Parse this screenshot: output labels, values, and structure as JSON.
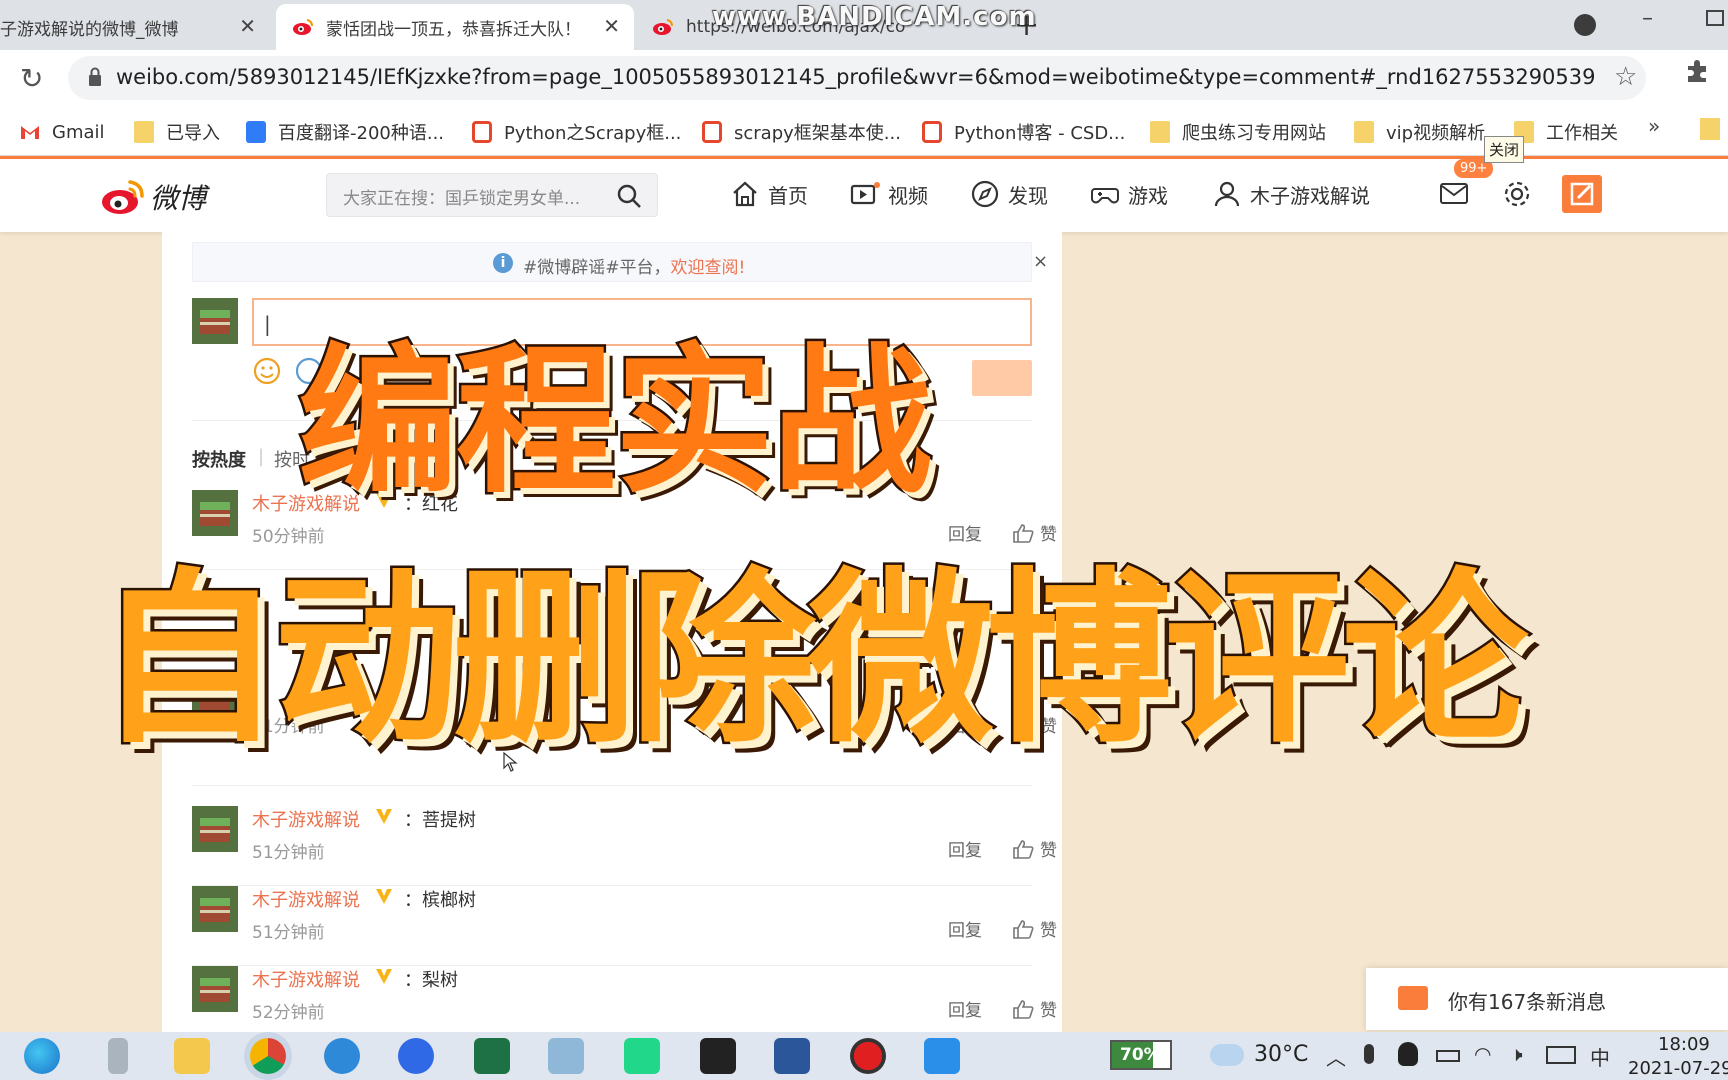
{
  "browser": {
    "tabs": [
      {
        "title": "子游戏解说的微博_微博",
        "close": "✕"
      },
      {
        "title": "蒙恬团战一顶五，恭喜拆迁大队！",
        "close": "✕"
      },
      {
        "title": "https://weibo.com/ajax/co",
        "close": ""
      }
    ],
    "new_tab": "+",
    "watermark": "www.BANDICAM.com",
    "url": "weibo.com/5893012145/IEfKjzxke?from=page_1005055893012145_profile&wvr=6&mod=weibotime&type=comment#_rnd1627553290539",
    "bookmarks": [
      {
        "label": "Gmail",
        "icon": "gmail-icon"
      },
      {
        "label": "已导入",
        "icon": "folder-icon"
      },
      {
        "label": "百度翻译-200种语...",
        "icon": "translate-icon"
      },
      {
        "label": "Python之Scrapy框...",
        "icon": "csdn-icon"
      },
      {
        "label": "scrapy框架基本使...",
        "icon": "csdn-icon"
      },
      {
        "label": "Python博客 - CSD...",
        "icon": "csdn-icon"
      },
      {
        "label": "爬虫练习专用网站",
        "icon": "folder-icon"
      },
      {
        "label": "vip视频解析",
        "icon": "folder-icon"
      },
      {
        "label": "工作相关",
        "icon": "folder-icon"
      }
    ],
    "bookmarks_more": "»",
    "tooltip": "关闭"
  },
  "weibo_nav": {
    "logo_text": "微博",
    "search_placeholder": "大家正在搜：国乒锁定男女单...",
    "items": [
      {
        "label": "首页",
        "icon": "home-icon"
      },
      {
        "label": "视频",
        "icon": "video-icon"
      },
      {
        "label": "发现",
        "icon": "compass-icon"
      },
      {
        "label": "游戏",
        "icon": "gamepad-icon"
      },
      {
        "label": "木子游戏解说",
        "icon": "user-icon"
      }
    ],
    "mail_badge": "99+",
    "accent": "#fa7d3c"
  },
  "feed": {
    "notice_text": "#微博辟谣#平台，",
    "notice_link": "欢迎查阅!",
    "notice_close": "×",
    "comment_caret": "|",
    "sort_hot": "按热度",
    "sort_sep": "|",
    "sort_time": "按时",
    "comments": [
      {
        "user": "木子游戏解说",
        "text": "：红花",
        "time": "50分钟前",
        "reply": "回复",
        "like": "赞"
      },
      {
        "user": "",
        "text": "",
        "time": "51分钟前",
        "reply": "回复",
        "like": "赞"
      },
      {
        "user": "木子游戏解说",
        "text": "：菩提树",
        "time": "51分钟前",
        "reply": "回复",
        "like": "赞"
      },
      {
        "user": "木子游戏解说",
        "text": "：槟榔树",
        "time": "51分钟前",
        "reply": "回复",
        "like": "赞"
      },
      {
        "user": "木子游戏解说",
        "text": "：梨树",
        "time": "52分钟前",
        "reply": "回复",
        "like": "赞"
      }
    ]
  },
  "overlay": {
    "line1": "编程实战",
    "line2": "自动删除微博评论"
  },
  "notification": {
    "text": "你有167条新消息"
  },
  "taskbar": {
    "battery": "70%",
    "battery_level": 0.7,
    "temperature": "30°C",
    "ime": "中",
    "time": "18:09",
    "date": "2021-07-29"
  }
}
